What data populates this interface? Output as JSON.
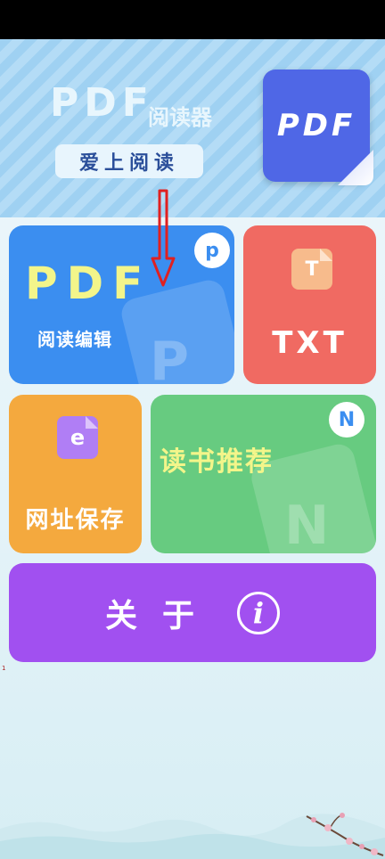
{
  "banner": {
    "title_big": "PDF",
    "title_small": "阅读器",
    "slogan": "爱上阅读",
    "card_text": "PDF"
  },
  "tiles": {
    "pdf": {
      "big": "PDF",
      "label": "阅读编辑",
      "badge": "p"
    },
    "txt": {
      "doc_letter": "T",
      "label": "TXT"
    },
    "url": {
      "doc_letter": "e",
      "label": "网址保存"
    },
    "books": {
      "label": "读书推荐",
      "badge": "N"
    },
    "about": {
      "label": "关于",
      "info_glyph": "i"
    }
  },
  "marker": "1",
  "icons": [
    "pdf-card-icon",
    "red-down-arrow-icon",
    "p-badge-icon",
    "txt-doc-icon",
    "e-doc-icon",
    "n-badge-icon",
    "info-icon",
    "blossom-branch-decoration"
  ],
  "colors": {
    "banner": "#9fd1f2",
    "pdf_tile": "#3b8ef0",
    "txt_tile": "#f06a62",
    "url_tile": "#f4a93e",
    "books_tile": "#67cb80",
    "about_tile": "#a150f0",
    "arrow": "#e02020"
  }
}
